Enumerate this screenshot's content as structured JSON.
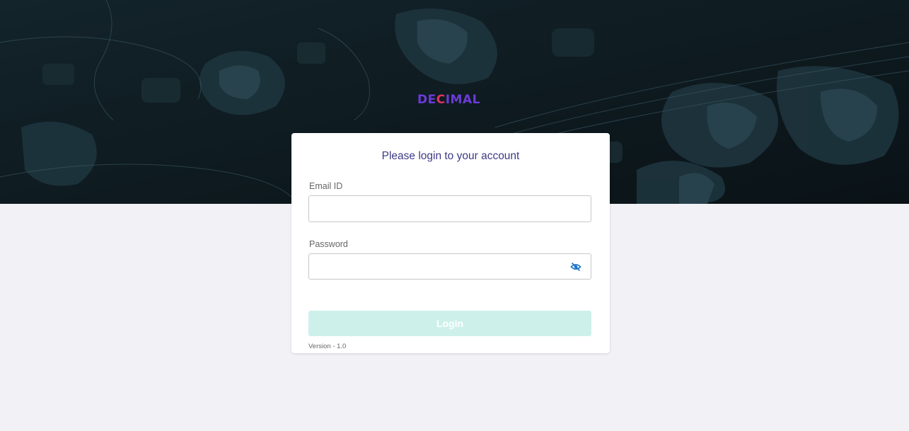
{
  "brand": {
    "logo_prefix": "DE",
    "logo_mid": "C",
    "logo_suffix": "IMAL"
  },
  "login": {
    "title": "Please login to your account",
    "email_label": "Email ID",
    "email_value": "",
    "password_label": "Password",
    "password_value": "",
    "password_toggle_icon": "eye-slash-icon",
    "submit_label": "Login",
    "version": "Version - 1.0"
  },
  "colors": {
    "accent": "#3c3a86",
    "button_disabled": "#cdf1ea",
    "logo_primary": "#6a3bd6",
    "logo_highlight": "#e23163",
    "hero_background": "#0b1418",
    "page_background": "#f1f1f6"
  }
}
